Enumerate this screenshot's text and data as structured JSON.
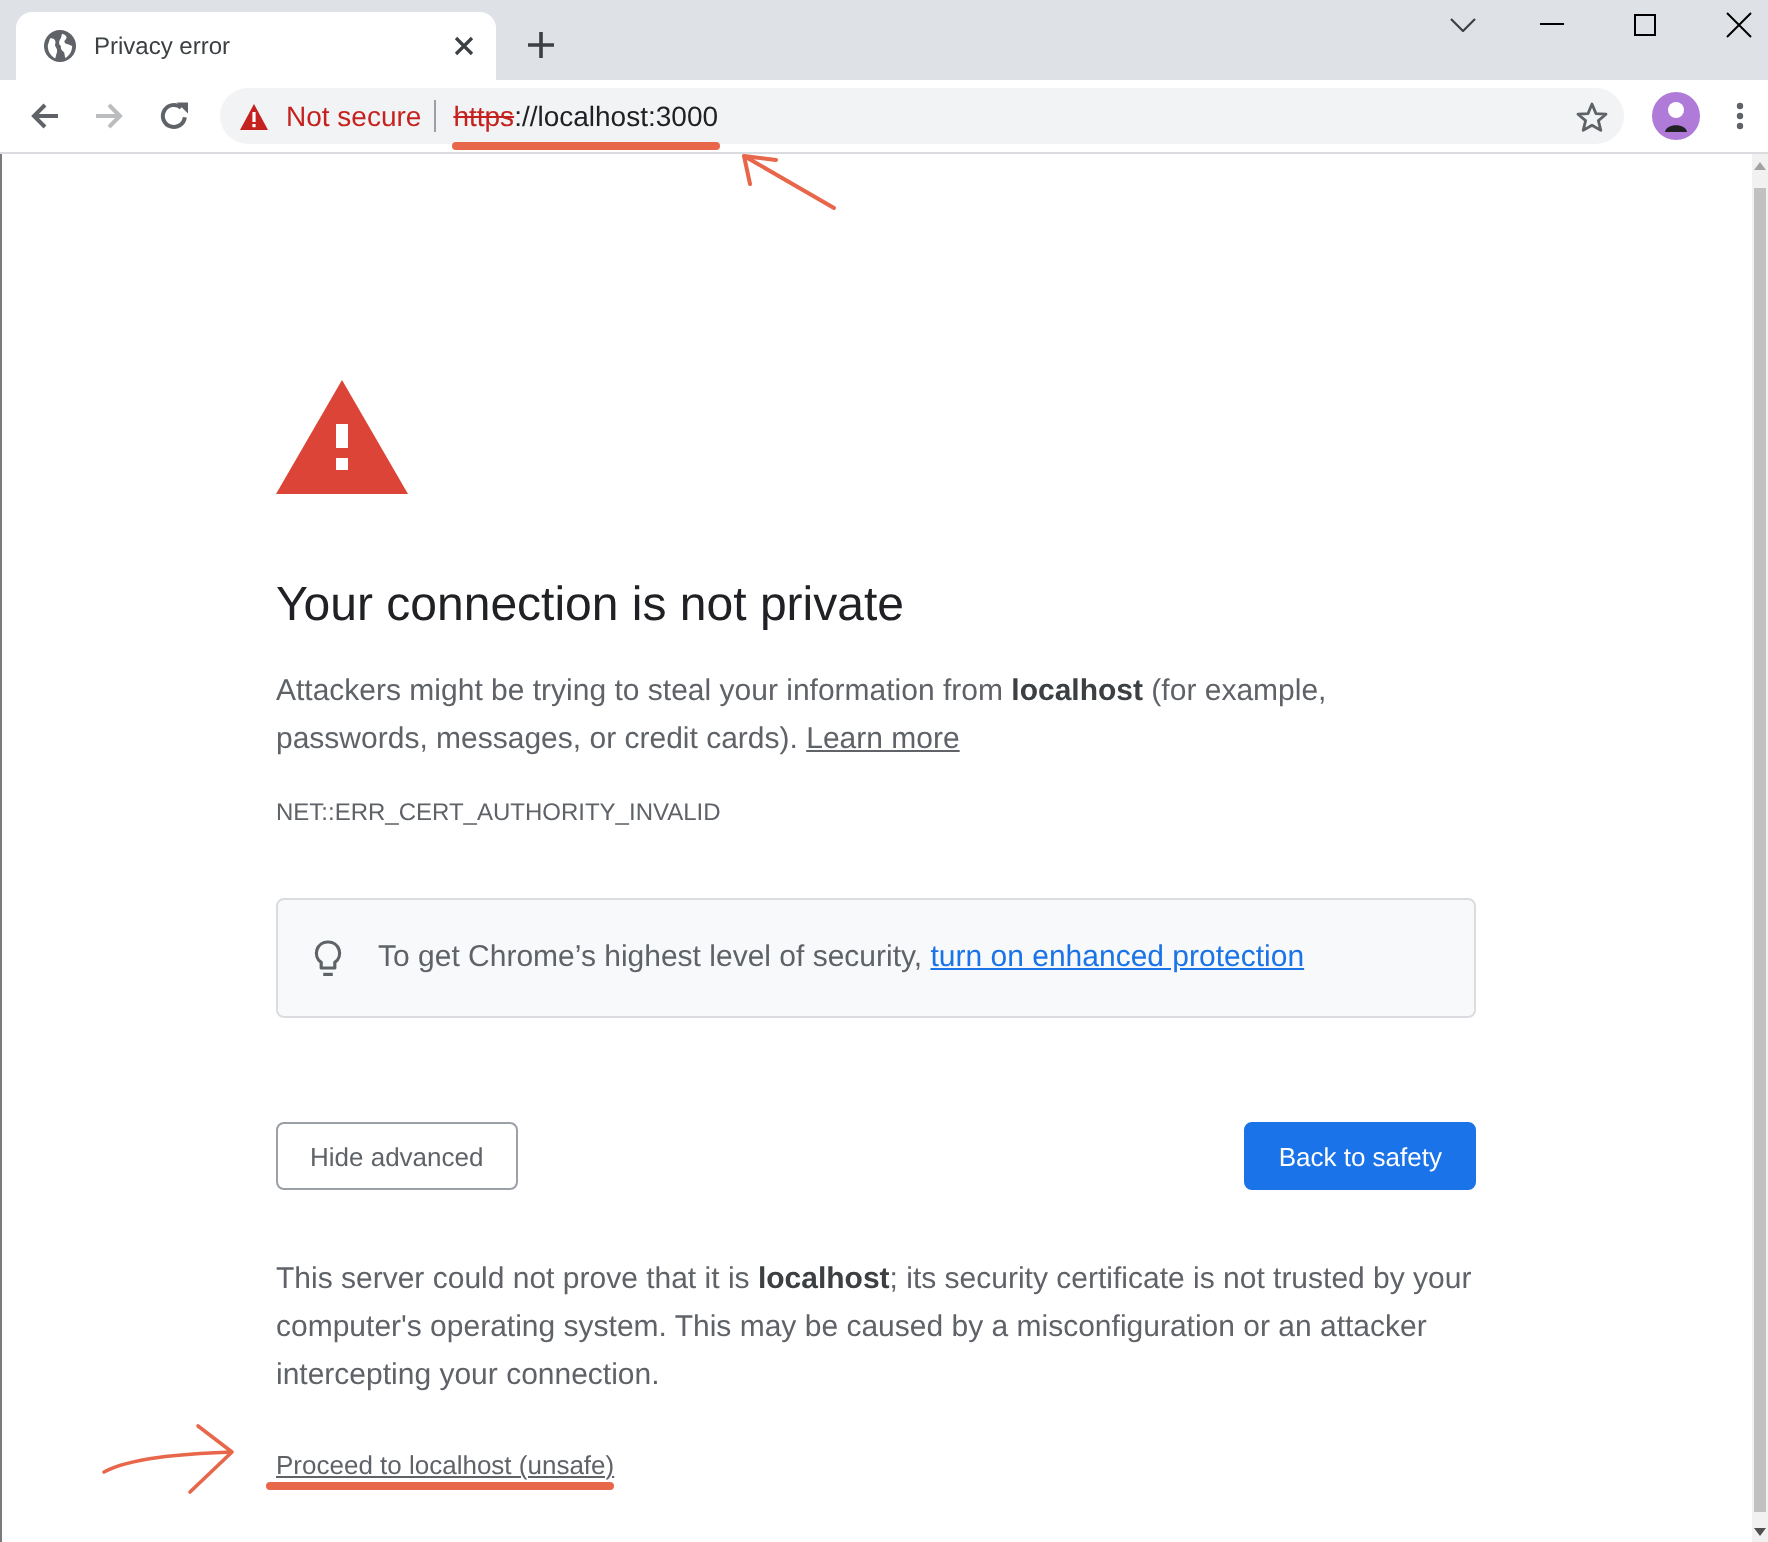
{
  "window": {
    "tabs": [
      {
        "title": "Privacy error",
        "selected": true
      }
    ]
  },
  "toolbar": {
    "back": {
      "disabled": false
    },
    "forward": {
      "disabled": true
    },
    "address_bar": {
      "secure": false,
      "security_label": "Not secure",
      "url_scheme": "https",
      "scheme_struck": true,
      "url_rest": "://localhost:3000",
      "annotated": true
    }
  },
  "page": {
    "heading": "Your connection is not private",
    "intro": "Attackers might be trying to steal your information from **localhost** (for example, passwords, messages, or credit cards).",
    "learn_more_link": "Learn more",
    "error_code": "NET::ERR_CERT_AUTHORITY_INVALID",
    "promo": {
      "text": "To get Chrome’s highest level of security,",
      "link": "turn on enhanced protection"
    },
    "buttons": [
      {
        "label": "Hide advanced",
        "kind": "secondary"
      },
      {
        "label": "Back to safety",
        "kind": "primary"
      }
    ],
    "details": "This server could not prove that it is **localhost**; its security certificate is not trusted by your computer's operating system. This may be caused by a misconfiguration or an attacker intercepting your connection.",
    "proceed_link": {
      "label": "Proceed to localhost (unsafe)",
      "annotated": true
    }
  }
}
